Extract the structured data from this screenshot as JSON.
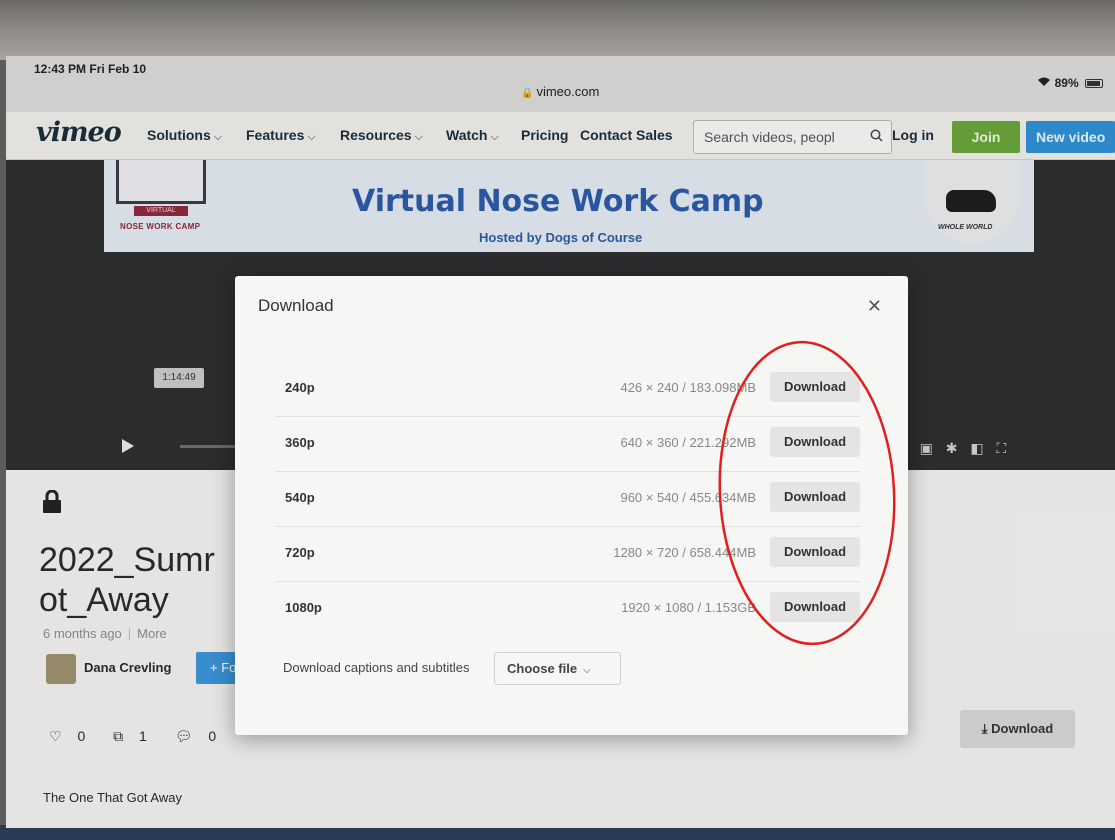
{
  "status_bar": {
    "time": "12:43 PM  Fri Feb 10",
    "url": "vimeo.com",
    "battery": "89%"
  },
  "nav": {
    "logo": "vimeo",
    "items": [
      {
        "label": "Solutions",
        "has_menu": true
      },
      {
        "label": "Features",
        "has_menu": true
      },
      {
        "label": "Resources",
        "has_menu": true
      },
      {
        "label": "Watch",
        "has_menu": true
      },
      {
        "label": "Pricing",
        "has_menu": false
      },
      {
        "label": "Contact Sales",
        "has_menu": false
      }
    ],
    "search_placeholder": "Search videos, peopl",
    "login": "Log in",
    "join": "Join",
    "new_video": "New video"
  },
  "video": {
    "banner_title": "Virtual Nose Work Camp",
    "banner_subtitle": "Hosted by Dogs of Course",
    "banner_logo_text": "NOSE WORK CAMP",
    "banner_logo_badge": "VIRTUAL",
    "banner_badge_text": "WHOLE WORLD",
    "timestamp": "1:14:49"
  },
  "page": {
    "title": "2022_Sumr\not_Away",
    "age": "6 months ago",
    "more": "More",
    "author": "Dana Crevling",
    "follow": "+ Fo",
    "likes": "0",
    "collections": "1",
    "comments": "0",
    "download_label": "Download",
    "description": "The One That Got Away"
  },
  "modal": {
    "title": "Download",
    "rows": [
      {
        "resolution": "240p",
        "size": "426 × 240 / 183.098MB",
        "button": "Download"
      },
      {
        "resolution": "360p",
        "size": "640 × 360 / 221.292MB",
        "button": "Download"
      },
      {
        "resolution": "540p",
        "size": "960 × 540 / 455.634MB",
        "button": "Download"
      },
      {
        "resolution": "720p",
        "size": "1280 × 720 / 658.444MB",
        "button": "Download"
      },
      {
        "resolution": "1080p",
        "size": "1920 × 1080 / 1.153GB",
        "button": "Download"
      }
    ],
    "captions_label": "Download captions and subtitles",
    "choose_file": "Choose file"
  },
  "annotation": {
    "color": "#e0201f"
  }
}
